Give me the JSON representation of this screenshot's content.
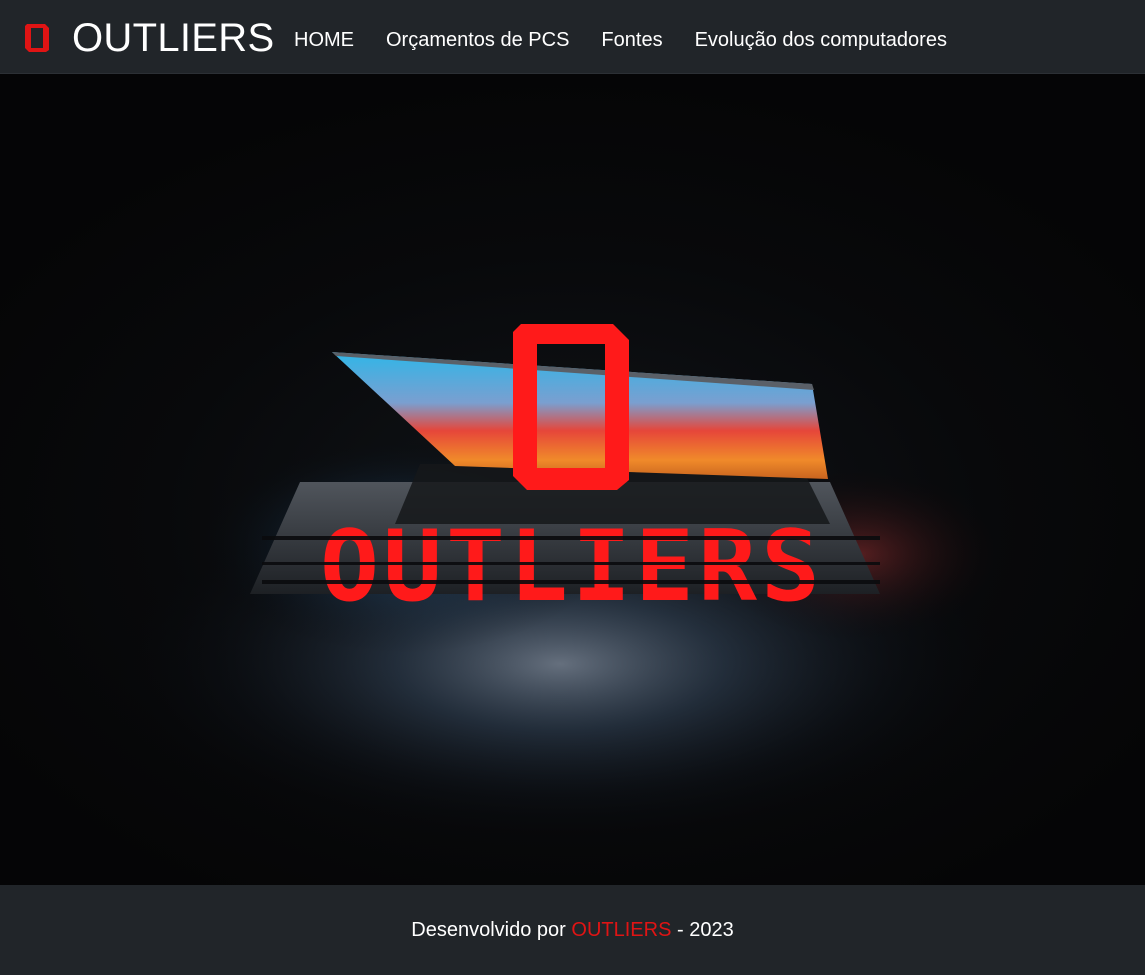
{
  "header": {
    "brand": {
      "name": "OUTLIERS",
      "icon": "outliers-logo-icon",
      "accent_color": "#e01414"
    },
    "nav": [
      {
        "label": "HOME"
      },
      {
        "label": "Orçamentos de PCS"
      },
      {
        "label": "Fontes"
      },
      {
        "label": "Evolução dos computadores"
      }
    ]
  },
  "hero": {
    "background_image": "dark laptop half-open with glowing blue-orange screen",
    "logo_text": "OUTLIERS",
    "logo_color": "#ff1a1a"
  },
  "footer": {
    "prefix": "Desenvolvido por ",
    "brand": "OUTLIERS",
    "suffix": " - 2023",
    "accent_color": "#e01414"
  }
}
